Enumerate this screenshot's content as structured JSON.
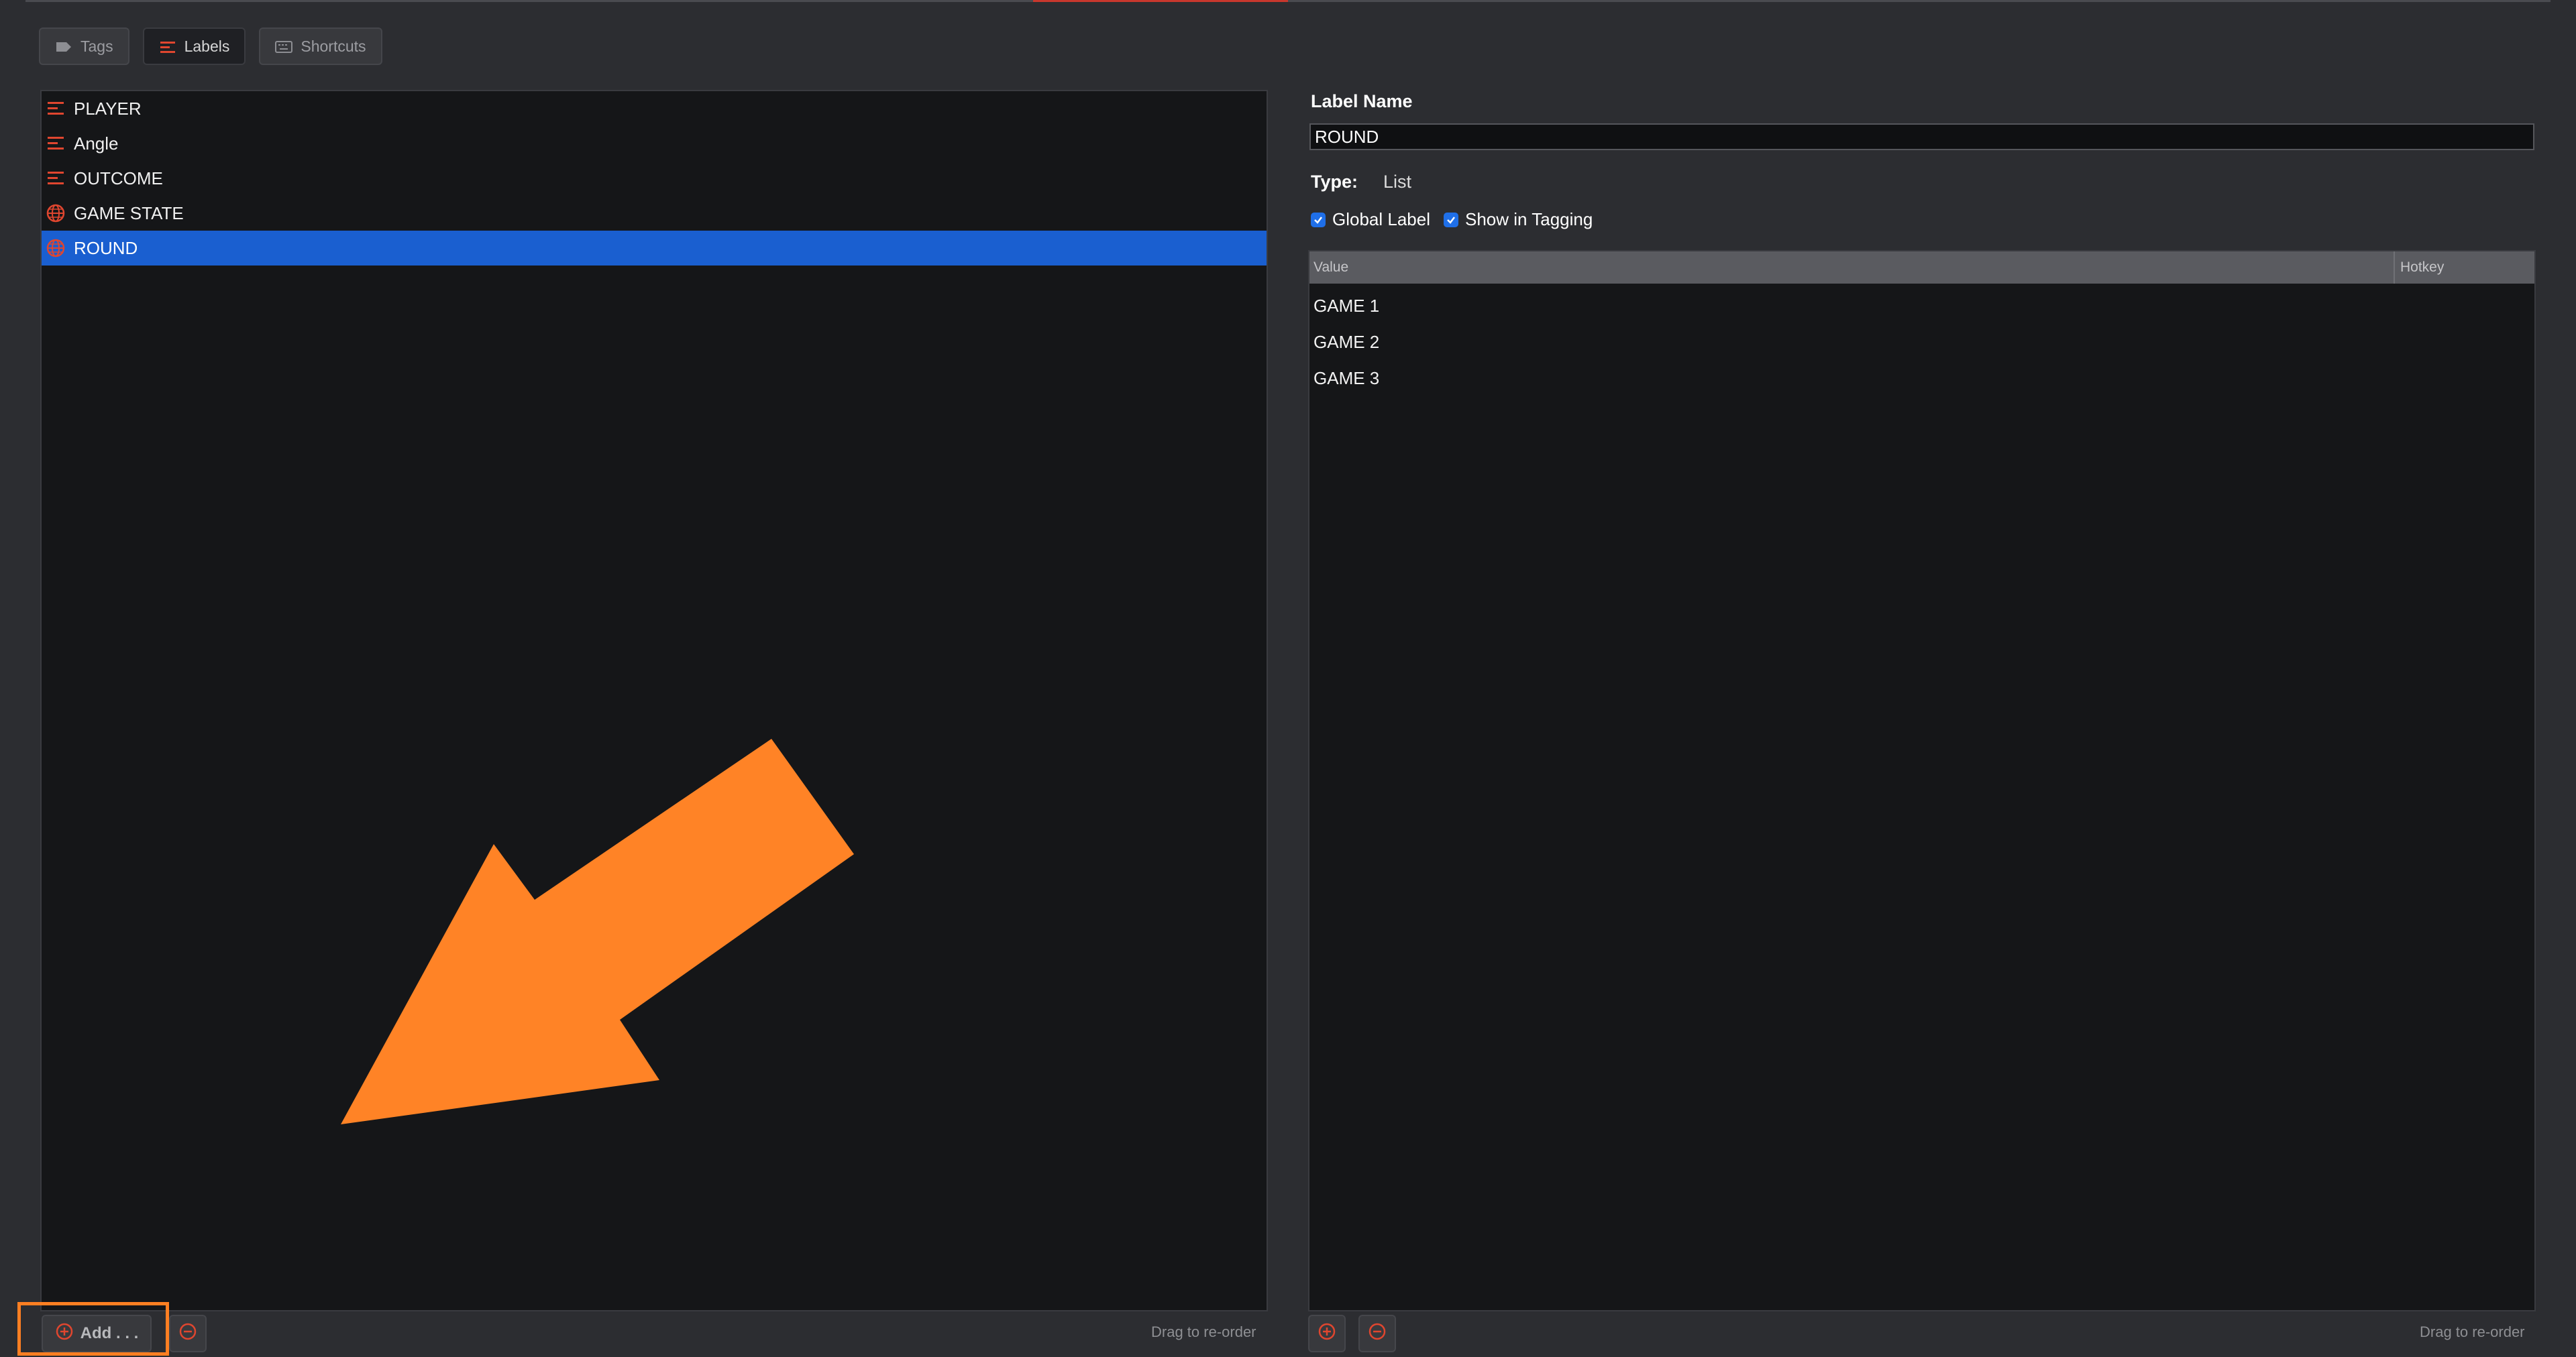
{
  "toolbar": {
    "tabs": [
      {
        "label": "Tags",
        "icon": "tag-icon",
        "active": false
      },
      {
        "label": "Labels",
        "icon": "list-icon",
        "active": true
      },
      {
        "label": "Shortcuts",
        "icon": "keyboard-icon",
        "active": false
      }
    ]
  },
  "labels_list": {
    "items": [
      {
        "label": "PLAYER",
        "icon": "list-icon",
        "selected": false
      },
      {
        "label": "Angle",
        "icon": "list-icon",
        "selected": false
      },
      {
        "label": "OUTCOME",
        "icon": "list-icon",
        "selected": false
      },
      {
        "label": "GAME STATE",
        "icon": "globe-icon",
        "selected": false
      },
      {
        "label": "ROUND",
        "icon": "globe-icon",
        "selected": true
      }
    ],
    "add_label": "Add . . .",
    "reorder_hint": "Drag to re-order"
  },
  "detail": {
    "name_heading": "Label Name",
    "name_value": "ROUND",
    "type_key": "Type:",
    "type_value": "List",
    "global_label": "Global Label",
    "global_checked": true,
    "show_in_tagging": "Show in Tagging",
    "show_checked": true,
    "table": {
      "columns": [
        "Value",
        "Hotkey"
      ],
      "rows": [
        "GAME 1",
        "GAME 2",
        "GAME 3"
      ]
    },
    "reorder_hint": "Drag to re-order"
  },
  "colors": {
    "accent": "#e0462f",
    "selection": "#1a5fd0",
    "annotation_arrow": "#ff8326",
    "checkbox": "#1f6fe8"
  }
}
